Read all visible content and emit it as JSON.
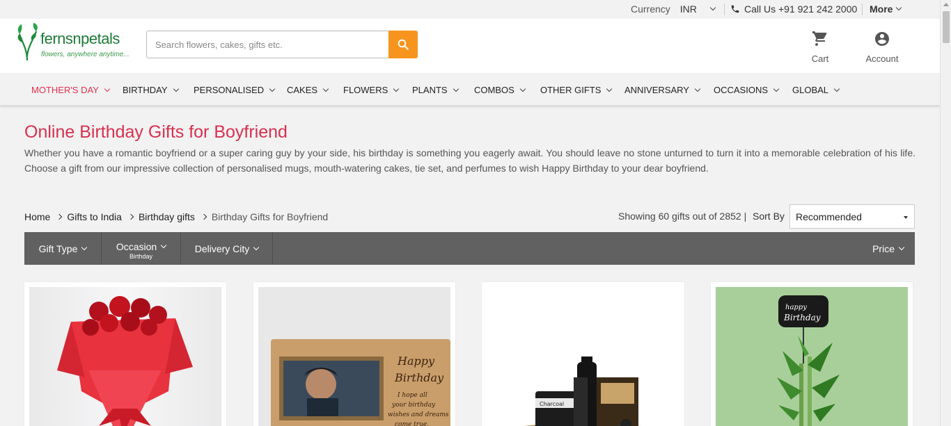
{
  "topbar": {
    "currency_label": "Currency",
    "currency_value": "INR",
    "call_label": "Call Us +91 921 242 2000",
    "more_label": "More"
  },
  "header": {
    "logo_brand": "fernsnpetals",
    "logo_tagline": "flowers, anywhere anytime...",
    "search_placeholder": "Search flowers, cakes, gifts etc.",
    "cart_label": "Cart",
    "account_label": "Account"
  },
  "nav": {
    "items": [
      {
        "label": "MOTHER'S DAY"
      },
      {
        "label": "BIRTHDAY"
      },
      {
        "label": "PERSONALISED"
      },
      {
        "label": "CAKES"
      },
      {
        "label": "FLOWERS"
      },
      {
        "label": "PLANTS"
      },
      {
        "label": "COMBOS"
      },
      {
        "label": "OTHER GIFTS"
      },
      {
        "label": "ANNIVERSARY"
      },
      {
        "label": "OCCASIONS"
      },
      {
        "label": "GLOBAL"
      }
    ]
  },
  "page": {
    "title": "Online Birthday Gifts for Boyfriend",
    "description": "Whether you have a romantic boyfriend or a super caring guy by your side, his birthday is something you eagerly await. You should leave no stone unturned to turn it into a memorable celebration of his life. Choose a gift from our impressive collection of personalised mugs, mouth-watering cakes, tie set, and perfumes to wish Happy Birthday to your dear boyfriend."
  },
  "breadcrumb": {
    "items": [
      "Home",
      "Gifts to India",
      "Birthday gifts"
    ],
    "current": "Birthday Gifts for Boyfriend"
  },
  "results": {
    "showing": "Showing 60 gifts out of 2852 |",
    "sort_label": "Sort By",
    "sort_value": "Recommended"
  },
  "filters": {
    "gift_type": "Gift Type",
    "occasion": "Occasion",
    "occasion_value": "Birthday",
    "delivery_city": "Delivery City",
    "price": "Price"
  },
  "products": [
    {
      "image": "red-roses-bouquet"
    },
    {
      "image": "happy-birthday-photo-frame"
    },
    {
      "image": "charcoal-grooming-kit"
    },
    {
      "image": "lucky-bamboo-plant"
    }
  ],
  "colors": {
    "accent_red": "#d8304f",
    "search_orange": "#f7941d",
    "filter_bar": "#616161",
    "logo_green": "#1d7a36"
  }
}
